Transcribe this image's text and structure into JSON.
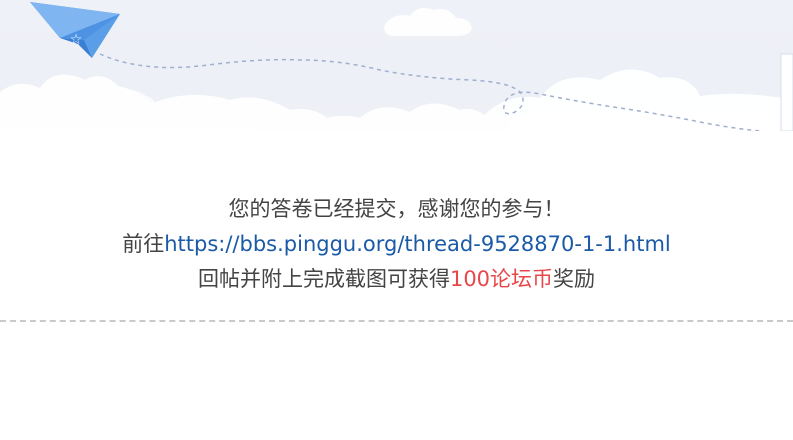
{
  "message": {
    "submitted_text": "您的答卷已经提交，感谢您的参与！",
    "goto_prefix": "前往",
    "thread_link": "https://bbs.pinggu.org/thread-9528870-1-1.html",
    "reward_prefix": "回帖并附上完成截图可获得",
    "reward_amount": "100论坛币",
    "reward_suffix": "奖励"
  },
  "icons": {
    "banner": "paper-plane-icon"
  },
  "colors": {
    "text": "#444444",
    "link": "#1a5aa6",
    "reward": "#e8474a",
    "banner_bg": "#eef1f7",
    "plane": "#4a90e2"
  }
}
